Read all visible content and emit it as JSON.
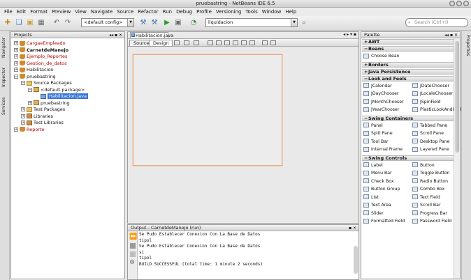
{
  "window": {
    "title": "pruebastring - NetBeans IDE 6.5"
  },
  "menu": [
    "File",
    "Edit",
    "Format",
    "Preview",
    "View",
    "Navigate",
    "Source",
    "Refactor",
    "Run",
    "Debug",
    "Profile",
    "Versioning",
    "Tools",
    "Window",
    "Help"
  ],
  "toolbar": {
    "config_value": "<default config>",
    "history_value": "liquidacion",
    "search_placeholder": "Search (Ctrl+I)"
  },
  "left_tabs": [
    "Navigator",
    "Inspector",
    "Services"
  ],
  "projects": {
    "title": "Projects",
    "items": [
      {
        "label": "CargaeEmpleado",
        "style": "red"
      },
      {
        "label": "CarnetdeManejo",
        "style": "bold"
      },
      {
        "label": "Ejemplo_Reportes",
        "style": "red"
      },
      {
        "label": "Gestion_de_datos",
        "style": "red"
      },
      {
        "label": "Habilitacion",
        "style": "normal"
      },
      {
        "label": "pruebastring",
        "style": "normal"
      },
      {
        "label": "Source Packages",
        "style": "normal"
      },
      {
        "label": "<default package>",
        "style": "normal"
      },
      {
        "label": "Habilitacion.java",
        "style": "selected"
      },
      {
        "label": "pruebastring",
        "style": "normal"
      },
      {
        "label": "Test Packages",
        "style": "normal"
      },
      {
        "label": "Libraries",
        "style": "normal"
      },
      {
        "label": "Test Libraries",
        "style": "normal"
      },
      {
        "label": "Reporte",
        "style": "red"
      }
    ]
  },
  "editor": {
    "tab": "Habilitacion.java",
    "source_label": "Source",
    "design_label": "Design"
  },
  "output": {
    "title": "Output - CarnetdeManejo (run)",
    "lines": [
      "Se Pudo Establecer Conexion Con La Base de Datos",
      "tipol",
      "Se Pudo Establecer Conexion Con La Base de Datos",
      "si",
      "tipol",
      "BUILD SUCCESSFUL (total time: 1 minute 2 seconds)"
    ]
  },
  "palette": {
    "title": "Palette",
    "categories": [
      {
        "name": "AWT",
        "expanded": false,
        "items": []
      },
      {
        "name": "Beans",
        "expanded": true,
        "items": [
          "Choose Bean"
        ]
      },
      {
        "name": "Borders",
        "expanded": false,
        "items": []
      },
      {
        "name": "Java Persistence",
        "expanded": false,
        "items": []
      },
      {
        "name": "Look and Feels",
        "expanded": true,
        "items": [
          "JCalendar",
          "JDateChooser",
          "JDayChooser",
          "JLocaleChooser",
          "JMonthChooser",
          "JSpinField",
          "JYearChooser",
          "PlasticLookAndFeel"
        ]
      },
      {
        "name": "Swing Containers",
        "expanded": true,
        "items": [
          "Panel",
          "Tabbed Pane",
          "Split Pane",
          "Scroll Pane",
          "Tool Bar",
          "Desktop Pane",
          "Internal Frame",
          "Layered Pane"
        ]
      },
      {
        "name": "Swing Controls",
        "expanded": true,
        "items": [
          "Label",
          "Button",
          "Menu Bar",
          "Toggle Button",
          "Check Box",
          "Radio Button",
          "Button Group",
          "Combo Box",
          "List",
          "Text Field",
          "Text Area",
          "Scroll Bar",
          "Slider",
          "Progress Bar",
          "Formatted Field",
          "Password Field"
        ]
      }
    ]
  },
  "right_tabs": [
    "Properties"
  ]
}
